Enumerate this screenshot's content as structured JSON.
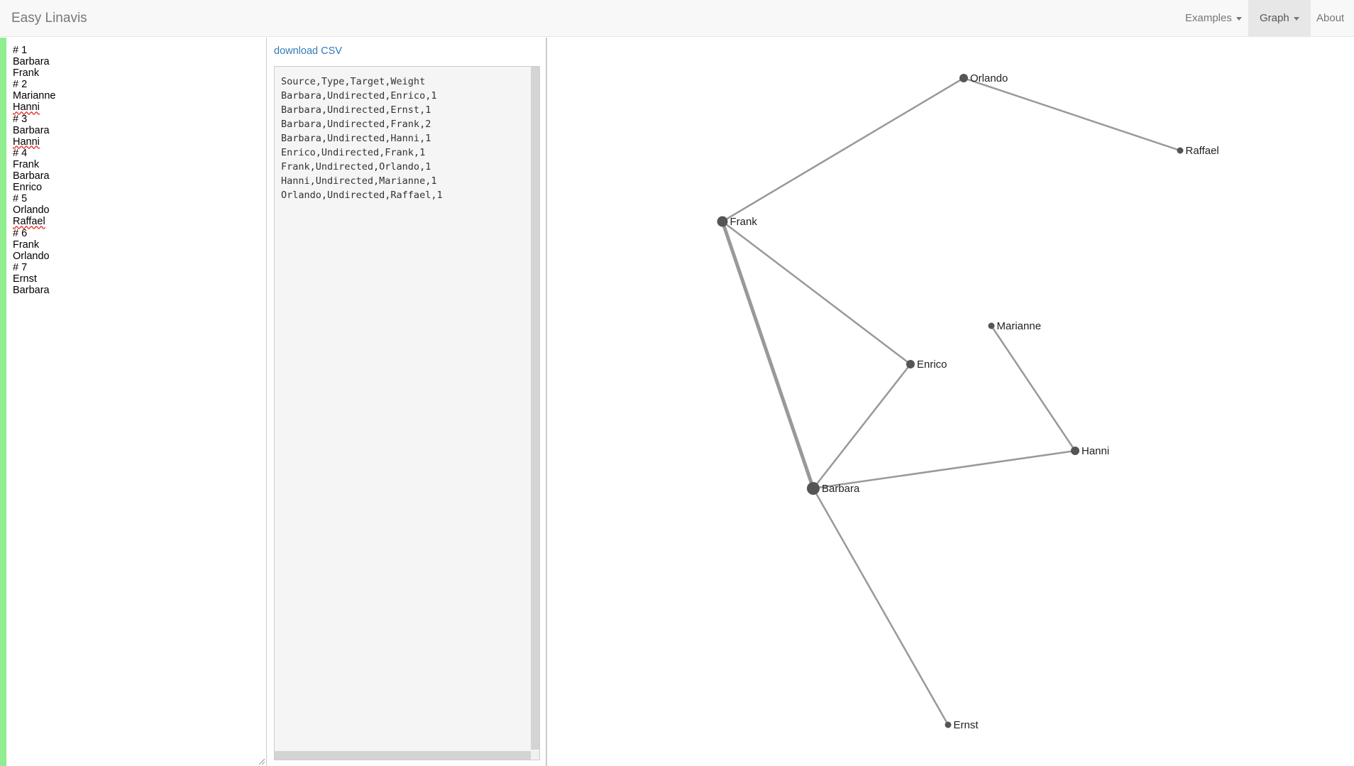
{
  "navbar": {
    "brand": "Easy Linavis",
    "examples_label": "Examples",
    "graph_label": "Graph",
    "about_label": "About"
  },
  "editor": {
    "lines": [
      {
        "text": "# 1",
        "spell": false
      },
      {
        "text": "Barbara",
        "spell": false
      },
      {
        "text": "Frank",
        "spell": false
      },
      {
        "text": "# 2",
        "spell": false
      },
      {
        "text": "Marianne",
        "spell": false
      },
      {
        "text": "Hanni",
        "spell": true
      },
      {
        "text": "# 3",
        "spell": false
      },
      {
        "text": "Barbara",
        "spell": false
      },
      {
        "text": "Hanni",
        "spell": true
      },
      {
        "text": "# 4",
        "spell": false
      },
      {
        "text": "Frank",
        "spell": false
      },
      {
        "text": "Barbara",
        "spell": false
      },
      {
        "text": "Enrico",
        "spell": false
      },
      {
        "text": "# 5",
        "spell": false
      },
      {
        "text": "Orlando",
        "spell": false
      },
      {
        "text": "Raffael",
        "spell": true
      },
      {
        "text": "# 6",
        "spell": false
      },
      {
        "text": "Frank",
        "spell": false
      },
      {
        "text": "Orlando",
        "spell": false
      },
      {
        "text": "# 7",
        "spell": false
      },
      {
        "text": "Ernst",
        "spell": false
      },
      {
        "text": "Barbara",
        "spell": false
      }
    ]
  },
  "csv": {
    "download_label": "download CSV",
    "lines": [
      "Source,Type,Target,Weight",
      "Barbara,Undirected,Enrico,1",
      "Barbara,Undirected,Ernst,1",
      "Barbara,Undirected,Frank,2",
      "Barbara,Undirected,Hanni,1",
      "Enrico,Undirected,Frank,1",
      "Frank,Undirected,Orlando,1",
      "Hanni,Undirected,Marianne,1",
      "Orlando,Undirected,Raffael,1"
    ]
  },
  "graph": {
    "nodes": [
      {
        "id": "Orlando",
        "degree": 2
      },
      {
        "id": "Raffael",
        "degree": 1
      },
      {
        "id": "Frank",
        "degree": 3
      },
      {
        "id": "Marianne",
        "degree": 1
      },
      {
        "id": "Enrico",
        "degree": 2
      },
      {
        "id": "Hanni",
        "degree": 2
      },
      {
        "id": "Barbara",
        "degree": 4
      },
      {
        "id": "Ernst",
        "degree": 1
      }
    ],
    "edges": [
      {
        "source": "Barbara",
        "target": "Enrico",
        "weight": 1
      },
      {
        "source": "Barbara",
        "target": "Ernst",
        "weight": 1
      },
      {
        "source": "Barbara",
        "target": "Frank",
        "weight": 2
      },
      {
        "source": "Barbara",
        "target": "Hanni",
        "weight": 1
      },
      {
        "source": "Enrico",
        "target": "Frank",
        "weight": 1
      },
      {
        "source": "Frank",
        "target": "Orlando",
        "weight": 1
      },
      {
        "source": "Hanni",
        "target": "Marianne",
        "weight": 1
      },
      {
        "source": "Orlando",
        "target": "Raffael",
        "weight": 1
      }
    ],
    "colors": {
      "node": "#555555",
      "edge": "#999999",
      "accent_bar": "#90ee90",
      "link": "#337ab7"
    }
  }
}
